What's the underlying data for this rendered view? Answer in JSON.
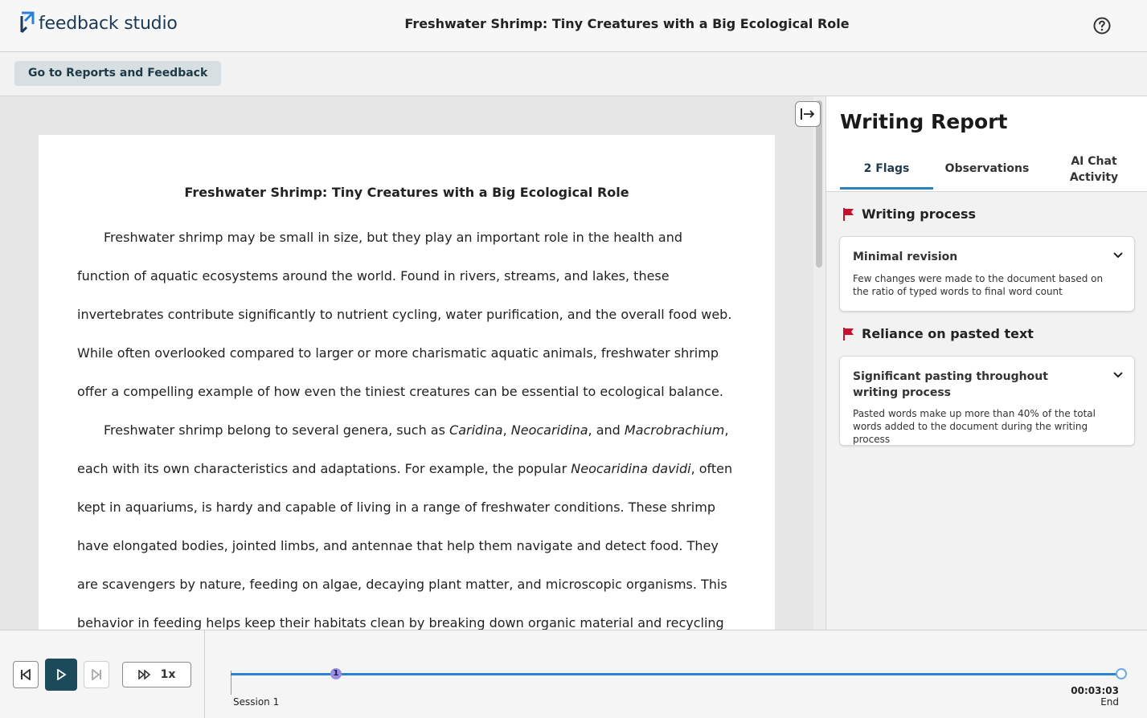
{
  "app": {
    "logo_text": "feedback studio",
    "document_title": "Freshwater Shrimp: Tiny Creatures with a Big Ecological Role",
    "help_icon": "question-circle-icon"
  },
  "toolbar": {
    "reports_button": "Go to Reports and Feedback"
  },
  "document": {
    "title": "Freshwater Shrimp: Tiny Creatures with a Big Ecological Role",
    "paragraph1": "Freshwater shrimp may be small in size, but they play an important role in the health and function of aquatic ecosystems around the world. Found in rivers, streams, and lakes, these invertebrates contribute significantly to nutrient cycling, water purification, and the overall food web. While often overlooked compared to larger or more charismatic aquatic animals, freshwater shrimp offer a compelling example of how even the tiniest creatures can be essential to ecological balance.",
    "p2": {
      "t1": "Freshwater shrimp belong to several genera, such as ",
      "g1": "Caridina",
      "t2": ", ",
      "g2": "Neocaridina",
      "t3": ", and ",
      "g3": "Macrobrachium",
      "t4": ", each with its own characteristics and adaptations. For example, the popular ",
      "g4": "Neocaridina davidi",
      "t5": ", often kept in aquariums, is hardy and capable of living in a range of freshwater conditions. These shrimp have elongated bodies, jointed limbs, and antennae that help them navigate and detect food. They are scavengers by nature, feeding on algae, decaying plant matter, and microscopic organisms. This behavior in feeding helps keep their habitats clean by breaking down organic material and recycling nutrients back into the ecosystem"
    }
  },
  "report": {
    "title": "Writing Report",
    "tabs": {
      "flags": "2 Flags",
      "observations": "Observations",
      "ai_chat": "AI Chat Activity"
    },
    "sections": [
      {
        "heading": "Writing process",
        "card_title": "Minimal revision",
        "card_desc": "Few changes were made to the document based on the ratio of typed words to final word count"
      },
      {
        "heading": "Reliance on pasted text",
        "card_title": "Significant pasting throughout writing process",
        "card_desc": "Pasted words make up more than 40% of the total words added to the document during the writing process"
      }
    ],
    "flag_color": "#c8102e"
  },
  "player": {
    "speed": "1x",
    "marker_label": "1",
    "session_label": "Session 1",
    "end_time": "00:03:03",
    "end_label": "End",
    "accent_color": "#2a82d8"
  }
}
